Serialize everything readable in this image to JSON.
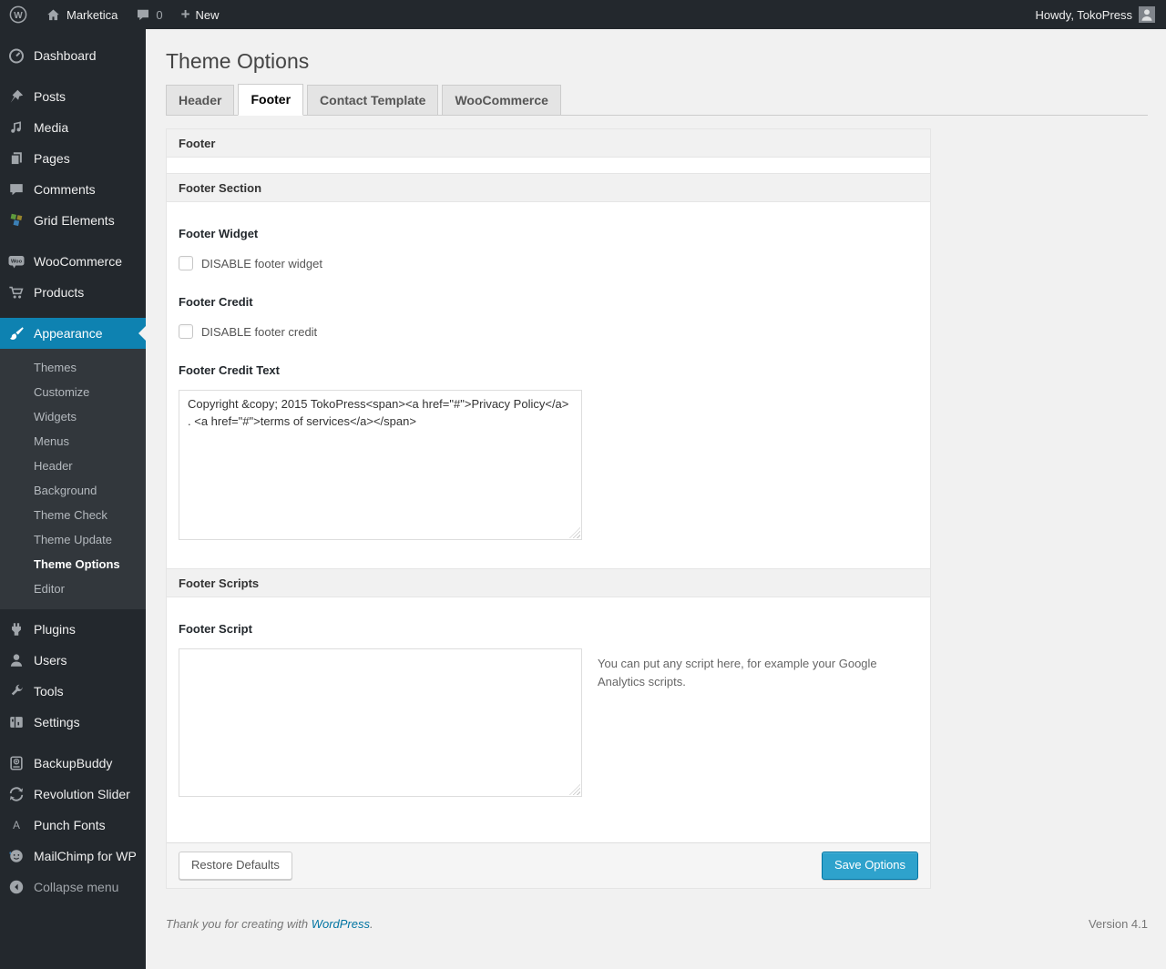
{
  "admin_bar": {
    "site_name": "Marketica",
    "comments_badge": "0",
    "new_label": "New",
    "howdy": "Howdy, TokoPress"
  },
  "sidebar": {
    "items": [
      {
        "label": "Dashboard"
      },
      {
        "label": "Posts"
      },
      {
        "label": "Media"
      },
      {
        "label": "Pages"
      },
      {
        "label": "Comments"
      },
      {
        "label": "Grid Elements"
      },
      {
        "label": "WooCommerce"
      },
      {
        "label": "Products"
      },
      {
        "label": "Appearance"
      },
      {
        "label": "Plugins"
      },
      {
        "label": "Users"
      },
      {
        "label": "Tools"
      },
      {
        "label": "Settings"
      },
      {
        "label": "BackupBuddy"
      },
      {
        "label": "Revolution Slider"
      },
      {
        "label": "Punch Fonts"
      },
      {
        "label": "MailChimp for WP"
      },
      {
        "label": "Collapse menu"
      }
    ],
    "appearance_submenu": [
      "Themes",
      "Customize",
      "Widgets",
      "Menus",
      "Header",
      "Background",
      "Theme Check",
      "Theme Update",
      "Theme Options",
      "Editor"
    ]
  },
  "page": {
    "title": "Theme Options",
    "tabs": [
      {
        "label": "Header"
      },
      {
        "label": "Footer"
      },
      {
        "label": "Contact Template"
      },
      {
        "label": "WooCommerce"
      }
    ],
    "panel": {
      "header_title": "Footer",
      "section_title": "Footer Section",
      "footer_widget_label": "Footer Widget",
      "footer_widget_checkbox": "DISABLE footer widget",
      "footer_credit_label": "Footer Credit",
      "footer_credit_checkbox": "DISABLE footer credit",
      "footer_credit_text_label": "Footer Credit Text",
      "footer_credit_text_value": "Copyright &copy; 2015 TokoPress<span><a href=\"#\">Privacy Policy</a> . <a href=\"#\">terms of services</a></span>",
      "scripts_section_title": "Footer Scripts",
      "footer_script_label": "Footer Script",
      "footer_script_value": "",
      "footer_script_hint": "You can put any script here, for example your Google Analytics scripts.",
      "restore_button": "Restore Defaults",
      "save_button": "Save Options"
    },
    "footer": {
      "thanks_prefix": "Thank you for creating with ",
      "wordpress_link": "WordPress",
      "thanks_suffix": ".",
      "version": "Version 4.1"
    }
  },
  "colors": {
    "admin_dark": "#23282d",
    "menu_highlight": "#0e82b1",
    "primary_button": "#2ea2cc",
    "link": "#0074a2"
  }
}
